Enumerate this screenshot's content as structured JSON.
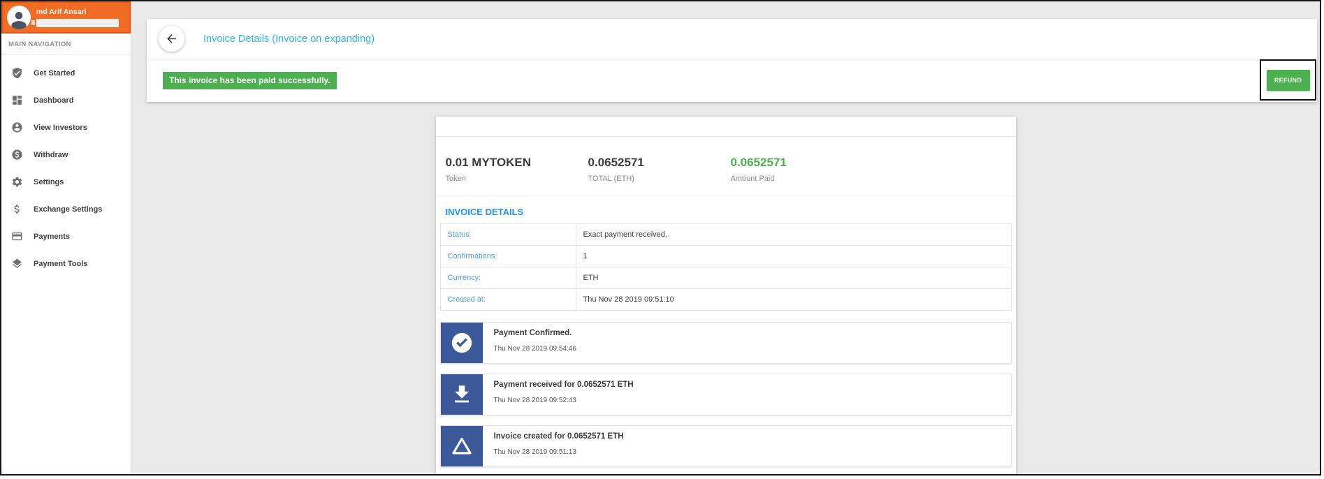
{
  "user": {
    "name": "md Arif Ansari"
  },
  "sidebar": {
    "section_label": "MAIN NAVIGATION",
    "items": [
      {
        "label": "Get Started",
        "icon": "shield-check-icon"
      },
      {
        "label": "Dashboard",
        "icon": "dashboard-grid-icon"
      },
      {
        "label": "View Investors",
        "icon": "person-circle-icon"
      },
      {
        "label": "Withdraw",
        "icon": "dollar-circle-icon"
      },
      {
        "label": "Settings",
        "icon": "gear-icon"
      },
      {
        "label": "Exchange Settings",
        "icon": "dollar-sign-icon"
      },
      {
        "label": "Payments",
        "icon": "credit-card-icon"
      },
      {
        "label": "Payment Tools",
        "icon": "layers-icon"
      }
    ]
  },
  "header": {
    "title": "Invoice Details (Invoice on expanding)",
    "banner": "This invoice has been paid successfully.",
    "refund_label": "REFUND"
  },
  "invoice": {
    "summary": [
      {
        "value": "0.01 MYTOKEN",
        "label": "Token"
      },
      {
        "value": "0.0652571",
        "label": "TOTAL (ETH)"
      },
      {
        "value": "0.0652571",
        "label": "Amount Paid",
        "color": "#4caf50"
      }
    ],
    "details_heading": "INVOICE DETAILS",
    "details": [
      {
        "label": "Status:",
        "value": "Exact payment received."
      },
      {
        "label": "Confirmations:",
        "value": "1"
      },
      {
        "label": "Currency:",
        "value": "ETH"
      },
      {
        "label": "Created at:",
        "value": "Thu Nov 28 2019 09:51:10"
      }
    ],
    "timeline": [
      {
        "icon": "check-circle-icon",
        "title": "Payment Confirmed.",
        "timestamp": "Thu Nov 28 2019 09:54:46"
      },
      {
        "icon": "download-icon",
        "title": "Payment received for 0.0652571 ETH",
        "timestamp": "Thu Nov 28 2019 09:52:43"
      },
      {
        "icon": "triangle-icon",
        "title": "Invoice created for 0.0652571 ETH",
        "timestamp": "Thu Nov 28 2019 09:51:13"
      }
    ]
  },
  "colors": {
    "accent_orange": "#f16c25",
    "title_blue": "#2cb6e6",
    "heading_blue": "#2095f2",
    "link_blue": "#4aa0e4",
    "success_green": "#4caf50",
    "timeline_blue": "#3c5a99",
    "page_background": "#e9e9e9"
  }
}
